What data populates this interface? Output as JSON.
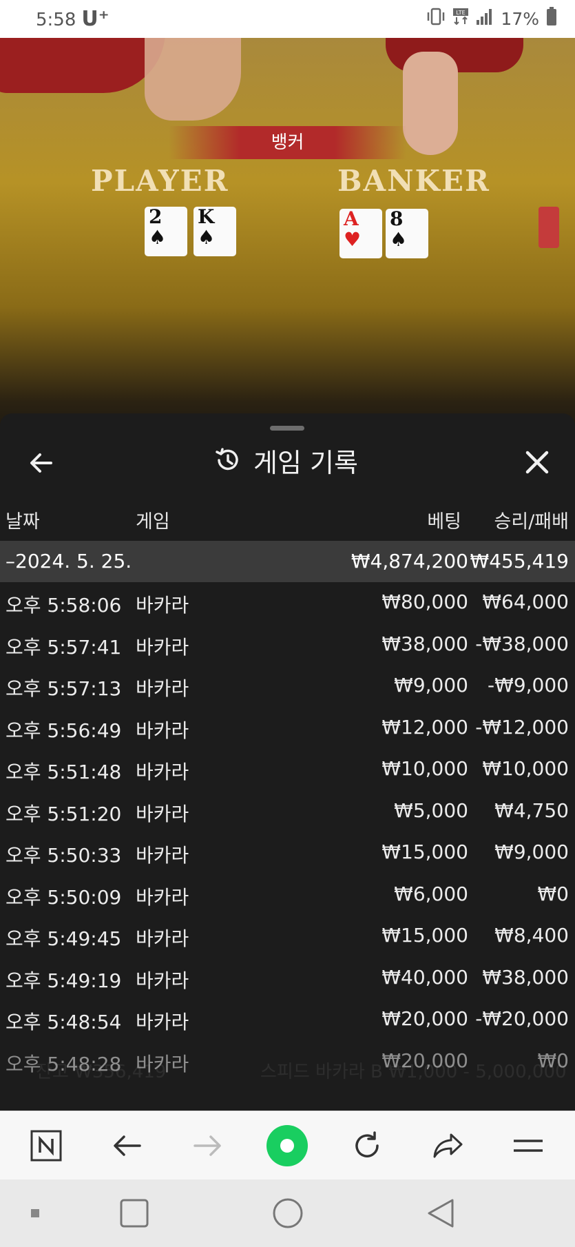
{
  "status": {
    "time": "5:58",
    "carrier": "U⁺",
    "battery": "17%"
  },
  "video": {
    "banner": "뱅커",
    "player_label": "PLAYER",
    "banker_label": "BANKER",
    "player_cards": [
      {
        "rank": "2",
        "suit": "♠"
      },
      {
        "rank": "K",
        "suit": "♠"
      }
    ],
    "banker_cards": [
      {
        "rank": "A",
        "suit": "♥"
      },
      {
        "rank": "8",
        "suit": "♠"
      }
    ]
  },
  "sheet": {
    "title": "게임 기록",
    "headers": {
      "date": "날짜",
      "game": "게임",
      "bet": "베팅",
      "result": "승리/패배"
    },
    "summary": {
      "date": "–2024. 5. 25.",
      "bet": "₩4,874,200",
      "result": "₩455,419"
    },
    "rows": [
      {
        "time": "오후 5:58:06",
        "game": "바카라",
        "bet": "₩80,000",
        "result": "₩64,000"
      },
      {
        "time": "오후 5:57:41",
        "game": "바카라",
        "bet": "₩38,000",
        "result": "-₩38,000"
      },
      {
        "time": "오후 5:57:13",
        "game": "바카라",
        "bet": "₩9,000",
        "result": "-₩9,000"
      },
      {
        "time": "오후 5:56:49",
        "game": "바카라",
        "bet": "₩12,000",
        "result": "-₩12,000"
      },
      {
        "time": "오후 5:51:48",
        "game": "바카라",
        "bet": "₩10,000",
        "result": "₩10,000"
      },
      {
        "time": "오후 5:51:20",
        "game": "바카라",
        "bet": "₩5,000",
        "result": "₩4,750"
      },
      {
        "time": "오후 5:50:33",
        "game": "바카라",
        "bet": "₩15,000",
        "result": "₩9,000"
      },
      {
        "time": "오후 5:50:09",
        "game": "바카라",
        "bet": "₩6,000",
        "result": "₩0"
      },
      {
        "time": "오후 5:49:45",
        "game": "바카라",
        "bet": "₩15,000",
        "result": "₩8,400"
      },
      {
        "time": "오후 5:49:19",
        "game": "바카라",
        "bet": "₩40,000",
        "result": "₩38,000"
      },
      {
        "time": "오후 5:48:54",
        "game": "바카라",
        "bet": "₩20,000",
        "result": "-₩20,000"
      },
      {
        "time": "오후 5:48:28",
        "game": "바카라",
        "bet": "₩20,000",
        "result": "₩0"
      }
    ],
    "background_ghost": {
      "balance": "잔고 ₩356,419",
      "table_info": "스피드 바카라 B ₩1,000 - 5,000,000"
    }
  },
  "browser": {
    "buttons": [
      "n-home-icon",
      "back-arrow-icon",
      "forward-arrow-icon",
      "green-dot-icon",
      "refresh-icon",
      "share-icon",
      "menu-icon"
    ]
  },
  "colors": {
    "accent_green": "#19ce60",
    "banner_red": "#b22a2a",
    "table_gold": "#b69226"
  }
}
